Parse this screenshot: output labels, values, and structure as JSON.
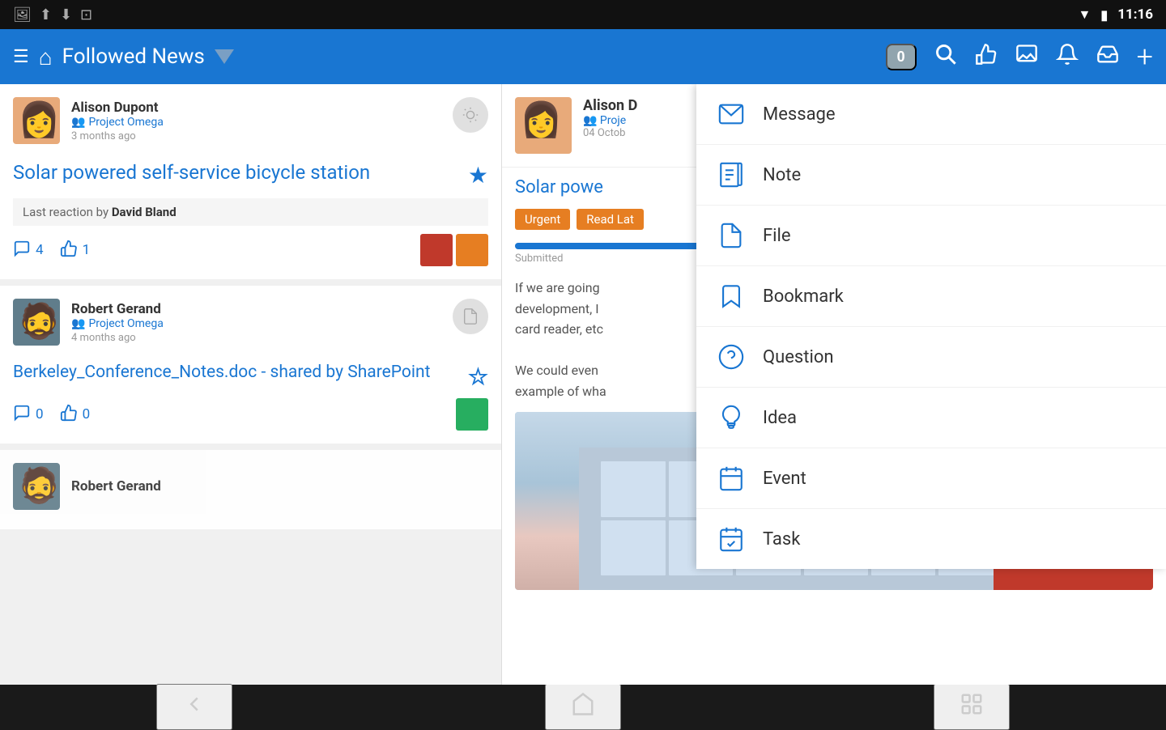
{
  "statusBar": {
    "time": "11:16",
    "icons": [
      "image-icon",
      "upload-icon",
      "download-icon",
      "save-icon"
    ]
  },
  "navBar": {
    "title": "Followed News",
    "badgeCount": "0",
    "buttons": [
      "search",
      "like",
      "comment",
      "notification",
      "inbox",
      "add"
    ]
  },
  "newsFeed": {
    "cards": [
      {
        "id": "card-1",
        "author": "Alison Dupont",
        "project": "Project Omega",
        "timeAgo": "3 months ago",
        "title": "Solar powered self-service bicycle station",
        "lastReaction": "Last reaction by",
        "lastReactionBy": "David Bland",
        "commentCount": "4",
        "likeCount": "1",
        "starred": true,
        "tags": [
          "red",
          "orange"
        ]
      },
      {
        "id": "card-2",
        "author": "Robert Gerand",
        "project": "Project Omega",
        "timeAgo": "4 months ago",
        "title": "Berkeley_Conference_Notes.doc - shared by SharePoint",
        "lastReaction": "",
        "lastReactionBy": "",
        "commentCount": "0",
        "likeCount": "0",
        "starred": false,
        "tags": [
          "green"
        ]
      },
      {
        "id": "card-3",
        "author": "Robert Gerand",
        "project": "",
        "timeAgo": "",
        "title": "",
        "commentCount": "",
        "likeCount": "",
        "starred": false,
        "tags": []
      }
    ]
  },
  "detailPanel": {
    "author": "Alison D",
    "project": "Proje",
    "date": "04 Octob",
    "title": "Solar powe",
    "tags": [
      "Urgent",
      "Read Lat"
    ],
    "progressLabel": "Submitted",
    "bodyText": "If we are going\ndevelopment, I\ncard reader, etc\n\nWe could even\nexample of wha",
    "imageAlt": "Building photo"
  },
  "dropdownMenu": {
    "items": [
      {
        "id": "message",
        "label": "Message",
        "icon": "message-icon"
      },
      {
        "id": "note",
        "label": "Note",
        "icon": "note-icon"
      },
      {
        "id": "file",
        "label": "File",
        "icon": "file-icon"
      },
      {
        "id": "bookmark",
        "label": "Bookmark",
        "icon": "bookmark-icon"
      },
      {
        "id": "question",
        "label": "Question",
        "icon": "question-icon"
      },
      {
        "id": "idea",
        "label": "Idea",
        "icon": "idea-icon"
      },
      {
        "id": "event",
        "label": "Event",
        "icon": "event-icon"
      },
      {
        "id": "task",
        "label": "Task",
        "icon": "task-icon"
      }
    ]
  },
  "bottomNav": {
    "buttons": [
      "back",
      "home",
      "recents"
    ]
  }
}
